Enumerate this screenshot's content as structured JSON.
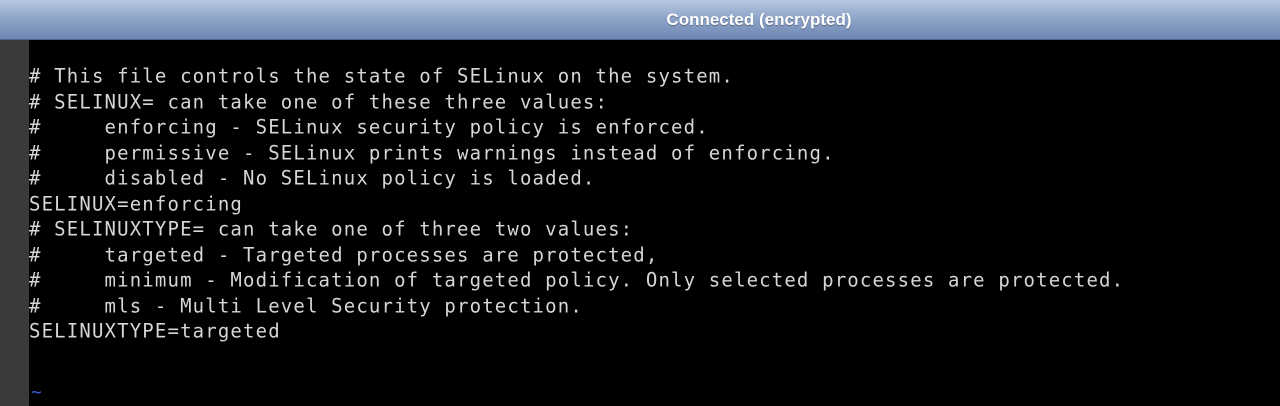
{
  "titlebar": {
    "title": "Connected (encrypted)"
  },
  "terminal": {
    "lines": [
      "# This file controls the state of SELinux on the system.",
      "# SELINUX= can take one of these three values:",
      "#     enforcing - SELinux security policy is enforced.",
      "#     permissive - SELinux prints warnings instead of enforcing.",
      "#     disabled - No SELinux policy is loaded.",
      "SELINUX=enforcing",
      "# SELINUXTYPE= can take one of three two values:",
      "#     targeted - Targeted processes are protected,",
      "#     minimum - Modification of targeted policy. Only selected processes are protected.",
      "#     mls - Multi Level Security protection.",
      "SELINUXTYPE=targeted"
    ],
    "empty_line_marker": "~"
  },
  "colors": {
    "terminal_background": "#000000",
    "terminal_text": "#d6d6d6",
    "tilde": "#3a5bd9",
    "titlebar_text": "#ffffff"
  }
}
